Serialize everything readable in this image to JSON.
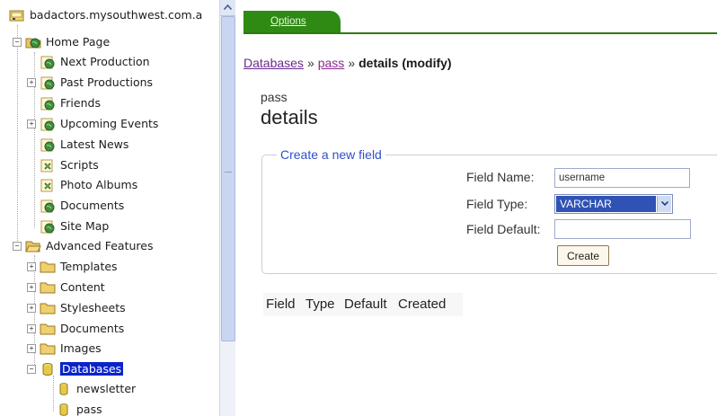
{
  "tree": {
    "root_label": "badactors.mysouthwest.com.a",
    "items": [
      {
        "label": "Home Page"
      },
      {
        "label": "Next Production"
      },
      {
        "label": "Past Productions"
      },
      {
        "label": "Friends"
      },
      {
        "label": "Upcoming Events"
      },
      {
        "label": "Latest News"
      },
      {
        "label": "Scripts"
      },
      {
        "label": "Photo Albums"
      },
      {
        "label": "Documents"
      },
      {
        "label": "Site Map"
      },
      {
        "label": "Advanced Features"
      },
      {
        "label": "Templates"
      },
      {
        "label": "Content"
      },
      {
        "label": "Stylesheets"
      },
      {
        "label": "Documents"
      },
      {
        "label": "Images"
      },
      {
        "label": "Databases",
        "selected": true
      },
      {
        "label": "newsletter"
      },
      {
        "label": "pass"
      }
    ]
  },
  "tabs": {
    "options_label": "Options"
  },
  "breadcrumb": {
    "databases": "Databases",
    "pass": "pass",
    "sep1": "»",
    "sep2": "»",
    "current": "details (modify)"
  },
  "page": {
    "table_name": "pass",
    "title": "details"
  },
  "form": {
    "legend": "Create a new field",
    "field_name_label": "Field Name:",
    "field_name_value": "username",
    "field_type_label": "Field Type:",
    "field_type_value": "VARCHAR",
    "field_default_label": "Field Default:",
    "field_default_value": "",
    "create_label": "Create"
  },
  "table": {
    "headers": [
      "Field",
      "Type",
      "Default",
      "Created"
    ]
  },
  "colors": {
    "tab_green": "#2f8a14",
    "link_purple": "#6a2a8e",
    "legend_blue": "#3050c8",
    "selection_blue": "#0a24c8"
  }
}
